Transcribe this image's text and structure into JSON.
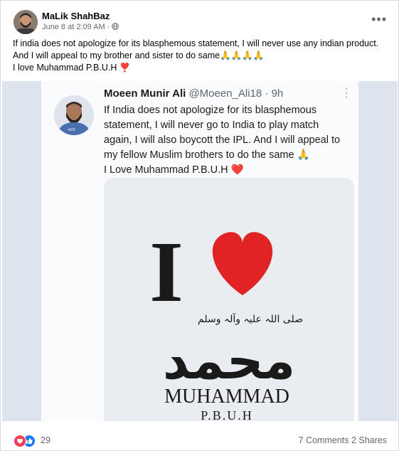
{
  "post": {
    "author": "MaLik ShahBaz",
    "timestamp": "June 8 at 2:09 AM",
    "audience_icon": "globe-icon",
    "more_icon": "more-horizontal-icon",
    "text_lines": [
      "If india does not apologize  for its blasphemous statement, I will never use any indian product.",
      "And I will appeal to my brother and sister to do same🙏🙏🙏🙏",
      "I love Muhammad P.B.U.H ❣️"
    ]
  },
  "tweet": {
    "name": "Moeen Munir Ali",
    "handle": "@Moeen_Ali18 · 9h",
    "text_lines": [
      "If India does not apologize for its blasphemous",
      "statement, I will never go to India to play match",
      "again, I will also boycott the IPL.  And I will appeal to",
      "my fellow Muslim brothers to do the same 🙏",
      "I Love Muhammad P.B.U.H ❤️"
    ],
    "image": {
      "big_letter": "I",
      "arabic": "محمد",
      "arabic_salutation": "صلی اللہ علیہ وآلہ وسلم",
      "name": "MUHAMMAD",
      "suffix": "P.B.U.H",
      "heart_color": "#e02424"
    }
  },
  "footer": {
    "reaction_count": "29",
    "reaction_icons": [
      "love-reaction-icon",
      "like-reaction-icon"
    ],
    "comments": "7 Comments",
    "shares": "2 Shares"
  },
  "colors": {
    "text": "#050505",
    "secondary": "#65676b",
    "love": "#f33e58",
    "like": "#1877f2"
  }
}
